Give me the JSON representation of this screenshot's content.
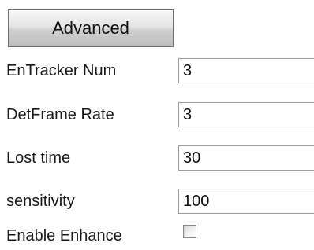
{
  "advanced_button": {
    "label": "Advanced"
  },
  "fields": [
    {
      "label": "EnTracker Num",
      "value": "3"
    },
    {
      "label": "DetFrame Rate",
      "value": "3"
    },
    {
      "label": "Lost time",
      "value": "30"
    },
    {
      "label": "sensitivity",
      "value": "100"
    }
  ],
  "enable_enhance": {
    "label": "Enable Enhance",
    "checked": false
  }
}
